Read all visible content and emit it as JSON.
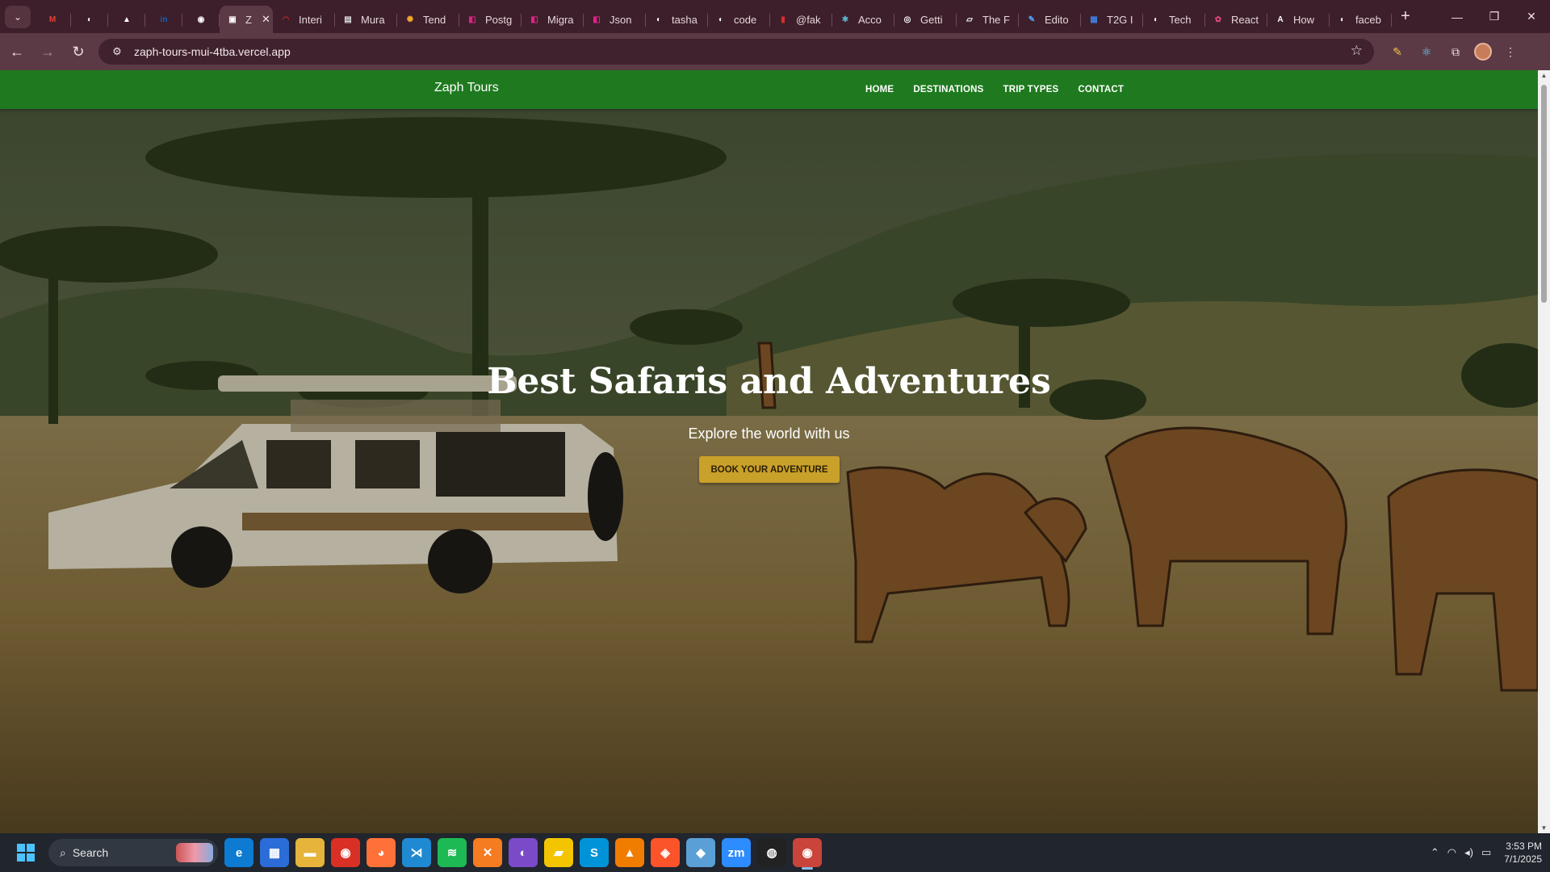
{
  "browser": {
    "tabs": [
      {
        "label": "",
        "icon": "gmail-icon",
        "color": "#ea4335",
        "glyph": "M"
      },
      {
        "label": "",
        "icon": "github-icon",
        "color": "#ffffff",
        "glyph": "◐"
      },
      {
        "label": "",
        "icon": "vercel-icon",
        "color": "#ffffff",
        "glyph": "▲"
      },
      {
        "label": "",
        "icon": "linkedin-icon",
        "color": "#0a66c2",
        "glyph": "in"
      },
      {
        "label": "",
        "icon": "chat-icon",
        "color": "#ffffff",
        "glyph": "◉"
      },
      {
        "label": "Z",
        "icon": "site-icon",
        "color": "#ffffff",
        "glyph": "▣",
        "active": true
      },
      {
        "label": "Interi",
        "icon": "tab-icon",
        "color": "#c62828",
        "glyph": "◠"
      },
      {
        "label": "Mura",
        "icon": "tab-icon",
        "color": "#dddddd",
        "glyph": "▤"
      },
      {
        "label": "Tend",
        "icon": "tab-icon",
        "color": "#f4a62a",
        "glyph": "✺"
      },
      {
        "label": "Postg",
        "icon": "tab-icon",
        "color": "#e0218a",
        "glyph": "◧"
      },
      {
        "label": "Migra",
        "icon": "tab-icon",
        "color": "#e0218a",
        "glyph": "◧"
      },
      {
        "label": "Json",
        "icon": "tab-icon",
        "color": "#e0218a",
        "glyph": "◧"
      },
      {
        "label": "tasha",
        "icon": "github-icon",
        "color": "#ffffff",
        "glyph": "◐"
      },
      {
        "label": "code",
        "icon": "github-icon",
        "color": "#ffffff",
        "glyph": "◐"
      },
      {
        "label": "@fak",
        "icon": "tab-icon",
        "color": "#d32f2f",
        "glyph": "▮"
      },
      {
        "label": "Acco",
        "icon": "tab-icon",
        "color": "#61dafb",
        "glyph": "⚛"
      },
      {
        "label": "Getti",
        "icon": "tab-icon",
        "color": "#ffffff",
        "glyph": "◎"
      },
      {
        "label": "The F",
        "icon": "tab-icon",
        "color": "#ffffff",
        "glyph": "▱"
      },
      {
        "label": "Edito",
        "icon": "tab-icon",
        "color": "#4fa3ff",
        "glyph": "✎"
      },
      {
        "label": "T2G I",
        "icon": "tab-icon",
        "color": "#3f7fe0",
        "glyph": "▦"
      },
      {
        "label": "Tech",
        "icon": "github-icon",
        "color": "#ffffff",
        "glyph": "◐"
      },
      {
        "label": "React",
        "icon": "tab-icon",
        "color": "#e0457b",
        "glyph": "✿"
      },
      {
        "label": "How",
        "icon": "tab-icon",
        "color": "#ffffff",
        "glyph": "A"
      },
      {
        "label": "faceb",
        "icon": "github-icon",
        "color": "#ffffff",
        "glyph": "◐"
      }
    ],
    "url": "zaph-tours-mui-4tba.vercel.app"
  },
  "site": {
    "brand": "Zaph Tours",
    "nav": [
      "HOME",
      "DESTINATIONS",
      "TRIP TYPES",
      "CONTACT"
    ],
    "hero": {
      "title": "Best Safaris and Adventures",
      "subtitle": "Explore the world with us",
      "cta": "BOOK YOUR ADVENTURE"
    },
    "colors": {
      "appbar": "#1f7a1f",
      "cta": "#c9a02a"
    }
  },
  "taskbar": {
    "search_label": "Search",
    "apps": [
      {
        "name": "edge-icon",
        "glyph": "e",
        "bg": "#0c7bd1"
      },
      {
        "name": "store-icon",
        "glyph": "▦",
        "bg": "#2b6cd8"
      },
      {
        "name": "file-explorer-icon",
        "glyph": "▬",
        "bg": "#e6b43a"
      },
      {
        "name": "chrome-icon",
        "glyph": "◉",
        "bg": "#d93025"
      },
      {
        "name": "firefox-icon",
        "glyph": "◕",
        "bg": "#ff7139"
      },
      {
        "name": "vscode-icon",
        "glyph": "⋊",
        "bg": "#1f8ad2"
      },
      {
        "name": "spotify-icon",
        "glyph": "≋",
        "bg": "#1db954"
      },
      {
        "name": "xampp-icon",
        "glyph": "✕",
        "bg": "#f57c20"
      },
      {
        "name": "github-desktop-icon",
        "glyph": "◐",
        "bg": "#7b4ac8"
      },
      {
        "name": "sticky-notes-icon",
        "glyph": "▰",
        "bg": "#f2c500"
      },
      {
        "name": "skype-icon",
        "glyph": "S",
        "bg": "#0093d8"
      },
      {
        "name": "vlc-icon",
        "glyph": "▲",
        "bg": "#f07d00"
      },
      {
        "name": "brave-icon",
        "glyph": "◈",
        "bg": "#fb542b"
      },
      {
        "name": "git-icon",
        "glyph": "◆",
        "bg": "#5aa0d6"
      },
      {
        "name": "zoom-icon",
        "glyph": "zm",
        "bg": "#2d8cff"
      },
      {
        "name": "figma-icon",
        "glyph": "◍",
        "bg": "#222222"
      },
      {
        "name": "chrome-profile-icon",
        "glyph": "◉",
        "bg": "#c9443a",
        "active": true
      }
    ],
    "time": "3:53 PM",
    "date": "7/1/2025"
  }
}
